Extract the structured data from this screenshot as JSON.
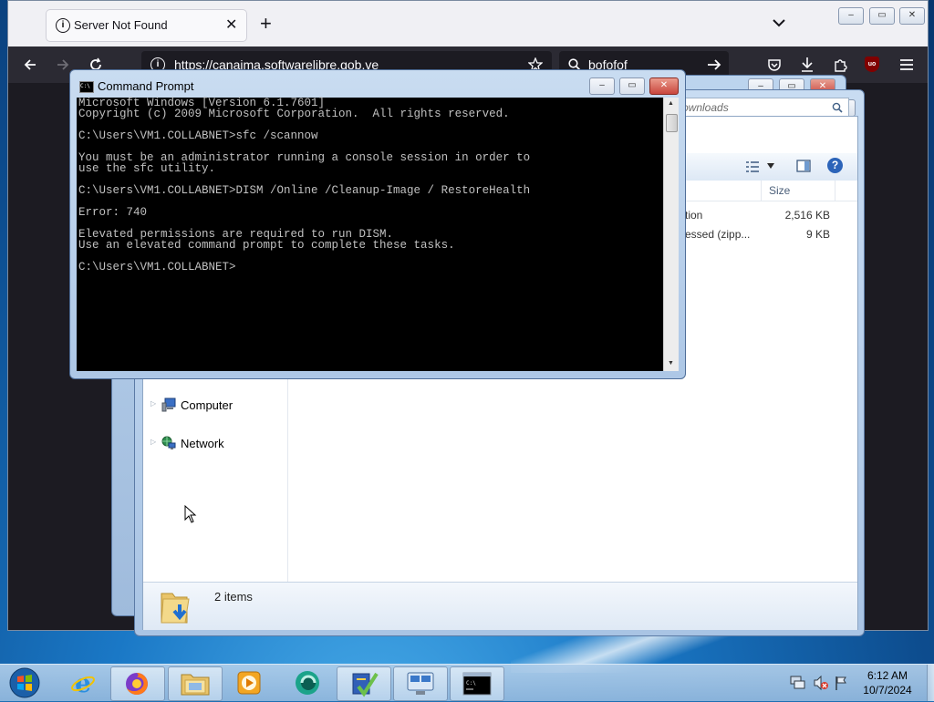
{
  "firefox": {
    "tab_title": "Server Not Found",
    "tab_close": "✕",
    "new_tab": "+",
    "tab_list": "⌄",
    "url": "https://canaima.softwarelibre.gob.ve",
    "search_text": "bofofof",
    "window_controls": {
      "minimize": "–",
      "maximize": "▭",
      "close": "✕"
    }
  },
  "explorer": {
    "address_text": "ownloads",
    "column_header": "Size",
    "files": [
      {
        "type": "tion",
        "size": "2,516 KB"
      },
      {
        "type": "essed (zipp...",
        "size": "9 KB"
      }
    ],
    "nav_items": [
      {
        "label": "Computer",
        "icon": "computer-icon"
      },
      {
        "label": "Network",
        "icon": "network-icon"
      }
    ],
    "status_text": "2 items",
    "window_controls": {
      "minimize": "–",
      "maximize": "▭",
      "close": "✕"
    }
  },
  "cmd": {
    "title": "Command Prompt",
    "icon_text": "C:\\",
    "output": "Microsoft Windows [Version 6.1.7601]\nCopyright (c) 2009 Microsoft Corporation.  All rights reserved.\n\nC:\\Users\\VM1.COLLABNET>sfc /scannow\n\nYou must be an administrator running a console session in order to\nuse the sfc utility.\n\nC:\\Users\\VM1.COLLABNET>DISM /Online /Cleanup-Image / RestoreHealth\n\nError: 740\n\nElevated permissions are required to run DISM.\nUse an elevated command prompt to complete these tasks.\n\nC:\\Users\\VM1.COLLABNET>",
    "window_controls": {
      "minimize": "–",
      "maximize": "▭",
      "close": "✕"
    }
  },
  "taskbar": {
    "items": [
      "start-orb",
      "internet-explorer",
      "firefox",
      "file-explorer",
      "media-player",
      "app-teal",
      "app-checklist",
      "app-network",
      "command-prompt"
    ],
    "time": "6:12 AM",
    "date": "10/7/2024"
  },
  "colors": {
    "firefox_toolbar": "#2b2a33",
    "cmd_background": "#000000",
    "cmd_text": "#c0c0c0",
    "close_button": "#c9463d"
  }
}
